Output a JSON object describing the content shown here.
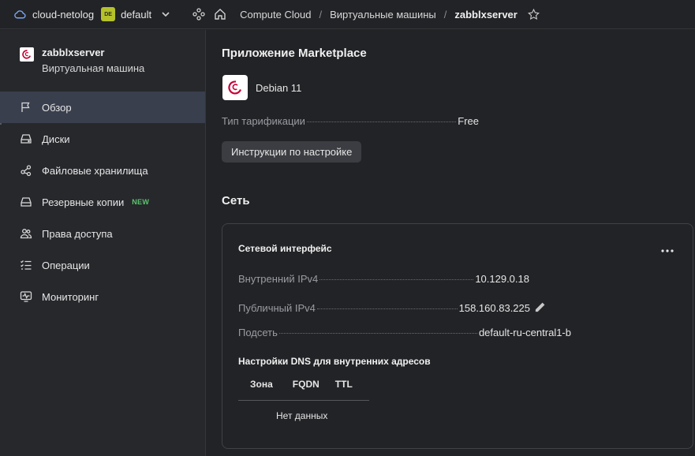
{
  "topbar": {
    "cloud_name": "cloud-netolog",
    "folder_badge": "DE",
    "folder_name": "default",
    "breadcrumbs": [
      "Compute Cloud",
      "Виртуальные машины",
      "zabblxserver"
    ],
    "separator": "/"
  },
  "sidebar": {
    "vm_name": "zabblxserver",
    "vm_type": "Виртуальная машина",
    "items": [
      {
        "label": "Обзор",
        "icon": "flag-icon",
        "active": true
      },
      {
        "label": "Диски",
        "icon": "disk-icon"
      },
      {
        "label": "Файловые хранилища",
        "icon": "share-icon"
      },
      {
        "label": "Резервные копии",
        "icon": "backup-icon",
        "badge": "NEW"
      },
      {
        "label": "Права доступа",
        "icon": "users-icon"
      },
      {
        "label": "Операции",
        "icon": "list-check-icon"
      },
      {
        "label": "Мониторинг",
        "icon": "monitor-icon"
      }
    ]
  },
  "marketplace": {
    "title": "Приложение Marketplace",
    "app_name": "Debian 11",
    "pricing_label": "Тип тарификации",
    "pricing_value": "Free",
    "instructions_button": "Инструкции по настройке"
  },
  "network": {
    "title": "Сеть",
    "card_title": "Сетевой интерфейс",
    "internal_ip_label": "Внутренний IPv4",
    "internal_ip": "10.129.0.18",
    "public_ip_label": "Публичный IPv4",
    "public_ip": "158.160.83.225",
    "subnet_label": "Подсеть",
    "subnet": "default-ru-central1-b",
    "dns_title": "Настройки DNS для внутренних адресов",
    "dns_columns": [
      "Зона",
      "FQDN",
      "TTL"
    ],
    "empty_text": "Нет данных"
  },
  "colors": {
    "accent_link": "#5e8fe6",
    "badge_new": "#5bc56e",
    "folder_badge": "#b5c22a",
    "active_nav": "#3a3f4e"
  }
}
